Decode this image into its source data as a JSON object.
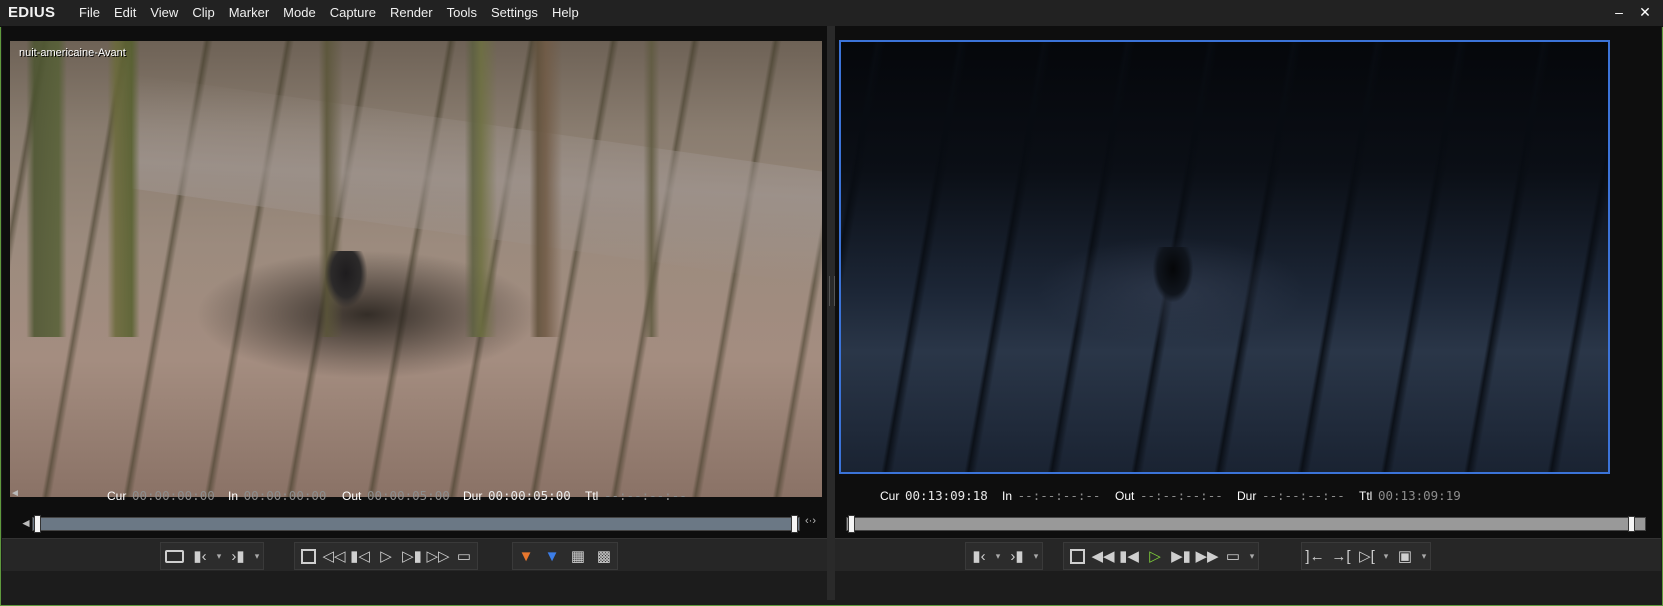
{
  "app": {
    "logo": "EDIUS",
    "menu": [
      "File",
      "Edit",
      "View",
      "Clip",
      "Marker",
      "Mode",
      "Capture",
      "Render",
      "Tools",
      "Settings",
      "Help"
    ],
    "window_controls": [
      "minimize",
      "close"
    ]
  },
  "player": {
    "clip_name": "nuit-americaine-Avant",
    "timecodes": {
      "cur": {
        "label": "Cur",
        "value": "00:00:00:00"
      },
      "in": {
        "label": "In",
        "value": "00:00:00:00"
      },
      "out": {
        "label": "Out",
        "value": "00:00:05:00"
      },
      "dur": {
        "label": "Dur",
        "value": "00:00:05:00"
      },
      "ttl": {
        "label": "Ttl",
        "value": "--:--:--:--"
      }
    },
    "scrub_position": 0,
    "buttons": [
      "clip-icon",
      "set-in-icon",
      "set-out-icon",
      "stop-icon",
      "rewind-icon",
      "step-back-icon",
      "play-icon",
      "step-forward-icon",
      "fast-forward-icon",
      "loop-icon",
      "insert-icon",
      "overwrite-icon",
      "add-to-bin-icon",
      "match-frame-icon"
    ]
  },
  "recorder": {
    "timecodes": {
      "cur": {
        "label": "Cur",
        "value": "00:13:09:18"
      },
      "in": {
        "label": "In",
        "value": "--:--:--:--"
      },
      "out": {
        "label": "Out",
        "value": "--:--:--:--"
      },
      "dur": {
        "label": "Dur",
        "value": "--:--:--:--"
      },
      "ttl": {
        "label": "Ttl",
        "value": "00:13:09:19"
      }
    },
    "scrub_position": 1,
    "buttons": [
      "set-in-icon",
      "set-out-icon",
      "stop-icon",
      "rewind-icon",
      "step-back-icon",
      "play-icon",
      "step-forward-icon",
      "fast-forward-icon",
      "loop-icon",
      "prev-edit-icon",
      "next-edit-icon",
      "cut-point-icon",
      "export-icon"
    ],
    "accent_color": "#3b73d8",
    "play_color": "#7fd13a"
  }
}
